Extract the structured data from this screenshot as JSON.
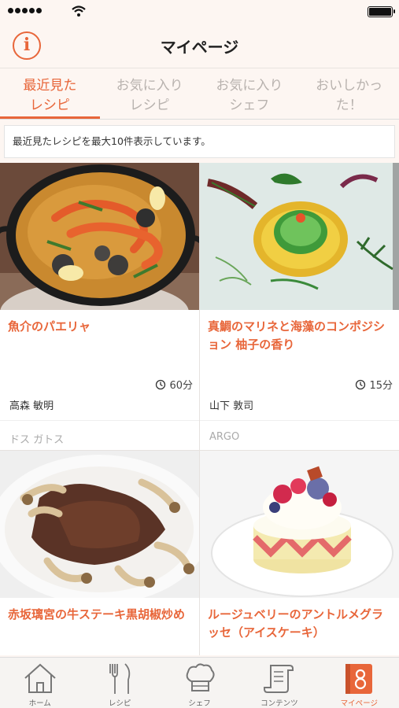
{
  "header": {
    "title": "マイページ",
    "info_label": "i"
  },
  "tabs": [
    {
      "label_line1": "最近見た",
      "label_line2": "レシピ",
      "active": true
    },
    {
      "label_line1": "お気に入り",
      "label_line2": "レシピ",
      "active": false
    },
    {
      "label_line1": "お気に入り",
      "label_line2": "シェフ",
      "active": false
    },
    {
      "label_line1": "おいしかっ",
      "label_line2": "た！",
      "active": false
    }
  ],
  "notice": "最近見たレシピを最大10件表示しています。",
  "recipes": [
    {
      "title": "魚介のパエリャ",
      "time": "60分",
      "chef": "高森 敏明",
      "restaurant": "ドス ガトス"
    },
    {
      "title": "真鯛のマリネと海藻のコンポジション 柚子の香り",
      "time": "15分",
      "chef": "山下 敦司",
      "restaurant": "ARGO"
    },
    {
      "title": "赤坂璃宮の牛ステーキ黒胡椒炒め"
    },
    {
      "title": "ルージュベリーのアントルメグラッセ（アイスケーキ）"
    }
  ],
  "tabbar": [
    {
      "label": "ホーム",
      "icon": "home-icon"
    },
    {
      "label": "レシピ",
      "icon": "fork-knife-icon"
    },
    {
      "label": "シェフ",
      "icon": "chef-hat-icon"
    },
    {
      "label": "コンテンツ",
      "icon": "scroll-icon"
    },
    {
      "label": "マイページ",
      "icon": "mypage-icon",
      "active": true
    }
  ],
  "colors": {
    "accent": "#e8663a"
  }
}
